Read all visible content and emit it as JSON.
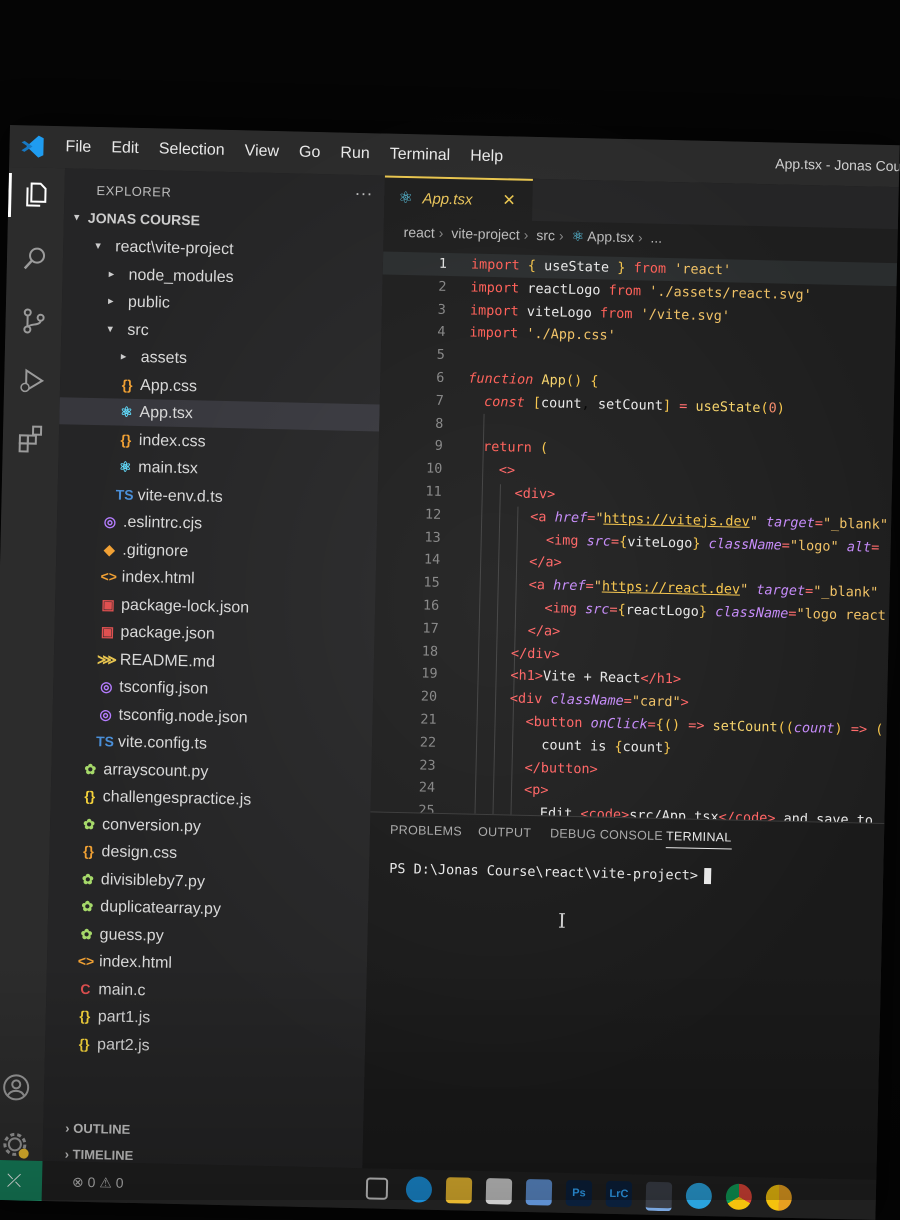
{
  "menu": [
    "File",
    "Edit",
    "Selection",
    "View",
    "Go",
    "Run",
    "Terminal",
    "Help"
  ],
  "window_title": "App.tsx - Jonas Cou",
  "activity_icons": [
    "files-icon",
    "search-icon",
    "source-control-icon",
    "run-debug-icon",
    "extensions-icon",
    "account-icon",
    "settings-gear-icon"
  ],
  "sidebar": {
    "header": "EXPLORER",
    "more": "···",
    "workspace": "JONAS COURSE",
    "tree": [
      {
        "name": "react\\vite-project",
        "type": "folder-open",
        "depth": 1
      },
      {
        "name": "node_modules",
        "type": "folder",
        "depth": 2
      },
      {
        "name": "public",
        "type": "folder",
        "depth": 2
      },
      {
        "name": "src",
        "type": "folder-open",
        "depth": 2
      },
      {
        "name": "assets",
        "type": "folder",
        "depth": 3
      },
      {
        "name": "App.css",
        "type": "css",
        "depth": 3
      },
      {
        "name": "App.tsx",
        "type": "react",
        "depth": 3,
        "selected": true
      },
      {
        "name": "index.css",
        "type": "css",
        "depth": 3
      },
      {
        "name": "main.tsx",
        "type": "react",
        "depth": 3
      },
      {
        "name": "vite-env.d.ts",
        "type": "ts",
        "depth": 3
      },
      {
        "name": ".eslintrc.cjs",
        "type": "eslint",
        "depth": 2
      },
      {
        "name": ".gitignore",
        "type": "git",
        "depth": 2
      },
      {
        "name": "index.html",
        "type": "html",
        "depth": 2
      },
      {
        "name": "package-lock.json",
        "type": "npm",
        "depth": 2
      },
      {
        "name": "package.json",
        "type": "npm",
        "depth": 2
      },
      {
        "name": "README.md",
        "type": "md",
        "depth": 2
      },
      {
        "name": "tsconfig.json",
        "type": "tsconfig",
        "depth": 2
      },
      {
        "name": "tsconfig.node.json",
        "type": "tsconfig",
        "depth": 2
      },
      {
        "name": "vite.config.ts",
        "type": "ts",
        "depth": 2
      },
      {
        "name": "arrayscount.py",
        "type": "py",
        "depth": 1
      },
      {
        "name": "challengespractice.js",
        "type": "js",
        "depth": 1
      },
      {
        "name": "conversion.py",
        "type": "py",
        "depth": 1
      },
      {
        "name": "design.css",
        "type": "css",
        "depth": 1
      },
      {
        "name": "divisibleby7.py",
        "type": "py",
        "depth": 1
      },
      {
        "name": "duplicatearray.py",
        "type": "py",
        "depth": 1
      },
      {
        "name": "guess.py",
        "type": "py",
        "depth": 1
      },
      {
        "name": "index.html",
        "type": "html",
        "depth": 1
      },
      {
        "name": "main.c",
        "type": "c",
        "depth": 1
      },
      {
        "name": "part1.js",
        "type": "js",
        "depth": 1
      },
      {
        "name": "part2.js",
        "type": "js",
        "depth": 1
      }
    ],
    "outline": "OUTLINE",
    "timeline": "TIMELINE"
  },
  "editor": {
    "tab_label": "App.tsx",
    "breadcrumb": [
      "react",
      "vite-project",
      "src",
      "App.tsx",
      "..."
    ],
    "current_line": 1,
    "line_numbers": [
      "1",
      "2",
      "3",
      "4",
      "5",
      "6",
      "7",
      "8",
      "9",
      "10",
      "11",
      "12",
      "13",
      "14",
      "15",
      "16",
      "17",
      "18",
      "19",
      "20",
      "21",
      "22",
      "23",
      "24",
      "25"
    ]
  },
  "panel": {
    "tabs": [
      "PROBLEMS",
      "OUTPUT",
      "DEBUG CONSOLE",
      "TERMINAL"
    ],
    "active_tab": "TERMINAL",
    "prompt": "PS D:\\Jonas Course\\react\\vite-project>"
  },
  "status": {
    "problems": "⊗ 0 ⚠ 0"
  },
  "taskbar_icons": [
    "task-view-icon",
    "edge-icon",
    "file-explorer-icon",
    "mail-icon",
    "store-icon",
    "photoshop-icon",
    "lightroom-icon",
    "vscode-icon",
    "telegram-icon",
    "chrome-icon",
    "chrome-canary-icon"
  ],
  "taskbar_labels": {
    "photoshop": "Ps",
    "lightroom": "LrC"
  }
}
